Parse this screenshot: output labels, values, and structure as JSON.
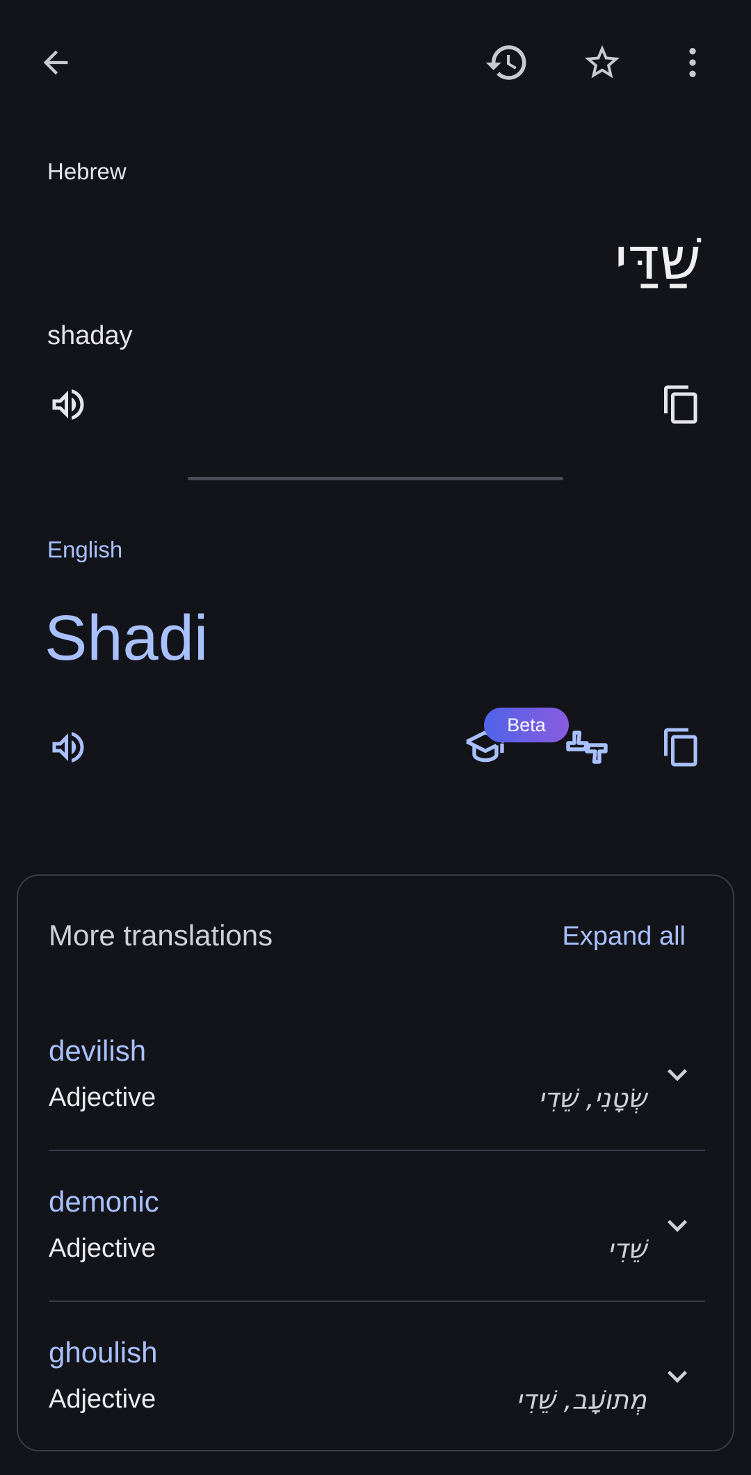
{
  "toolbar": {
    "back_icon": "arrow-left-icon",
    "history_icon": "history-icon",
    "star_icon": "star-outline-icon",
    "menu_icon": "more-vert-icon"
  },
  "source": {
    "language": "Hebrew",
    "text": "שַׁדַּי",
    "transliteration": "shaday",
    "listen_icon": "speaker-icon",
    "copy_icon": "copy-icon"
  },
  "target": {
    "language": "English",
    "text": "Shadi",
    "beta_label": "Beta",
    "listen_icon": "speaker-icon",
    "learn_icon": "graduation-cap-icon",
    "feedback_icon": "thumbs-up-down-icon",
    "copy_icon": "copy-icon"
  },
  "more_translations": {
    "title": "More translations",
    "expand_label": "Expand all",
    "items": [
      {
        "word": "devilish",
        "pos": "Adjective",
        "reverse": "שְׂטָנִי, שֵׁדִי"
      },
      {
        "word": "demonic",
        "pos": "Adjective",
        "reverse": "שֵׁדִי"
      },
      {
        "word": "ghoulish",
        "pos": "Adjective",
        "reverse": "מְתוֹעָב, שֵׁדִי"
      }
    ]
  },
  "colors": {
    "background": "#13141a",
    "accent": "#a9c1ff",
    "text": "#e6e6ea",
    "border": "#3a3c46"
  }
}
